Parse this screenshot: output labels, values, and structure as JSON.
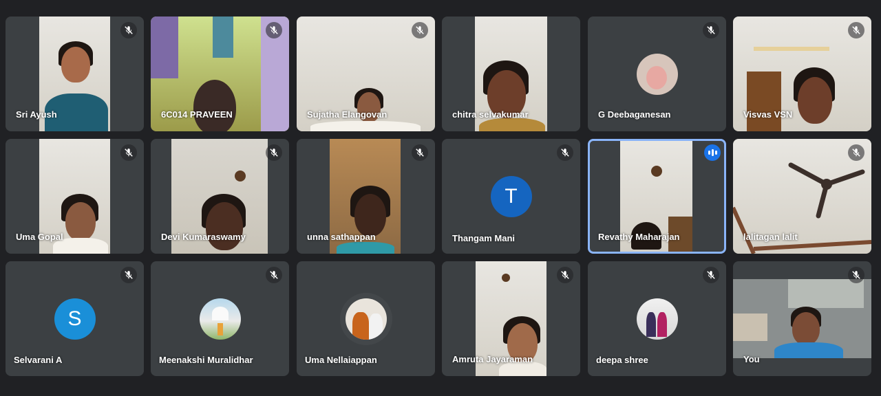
{
  "participants": [
    {
      "name": "Sri Ayush",
      "muted": true
    },
    {
      "name": "6C014 PRAVEEN",
      "muted": true
    },
    {
      "name": "Sujatha Elangovan",
      "muted": true
    },
    {
      "name": "chitra selvakumar",
      "muted": false
    },
    {
      "name": "G Deebaganesan",
      "muted": true
    },
    {
      "name": "Visvas VSN",
      "muted": true
    },
    {
      "name": "Uma Gopal",
      "muted": true
    },
    {
      "name": "Devi Kumaraswamy",
      "muted": true
    },
    {
      "name": "unna sathappan",
      "muted": true
    },
    {
      "name": "Thangam Mani",
      "muted": true,
      "initial": "T"
    },
    {
      "name": "Revathy Maharajan",
      "muted": false,
      "speaking": true
    },
    {
      "name": "lalitagan lalit",
      "muted": true
    },
    {
      "name": "Selvarani A",
      "muted": true,
      "initial": "S"
    },
    {
      "name": "Meenakshi Muralidhar",
      "muted": true
    },
    {
      "name": "Uma Nellaiappan",
      "muted": false
    },
    {
      "name": "Amruta Jayaraman",
      "muted": true
    },
    {
      "name": "deepa shree",
      "muted": true
    },
    {
      "name": "You",
      "muted": true
    }
  ],
  "colors": {
    "background": "#202124",
    "tile": "#3c4043",
    "speaking_border": "#8ab4f8",
    "avatar_T": "#1565c0",
    "avatar_S": "#1a8fd8"
  },
  "icons": {
    "muted": "mic-off-icon",
    "speaking": "audio-level-icon"
  }
}
